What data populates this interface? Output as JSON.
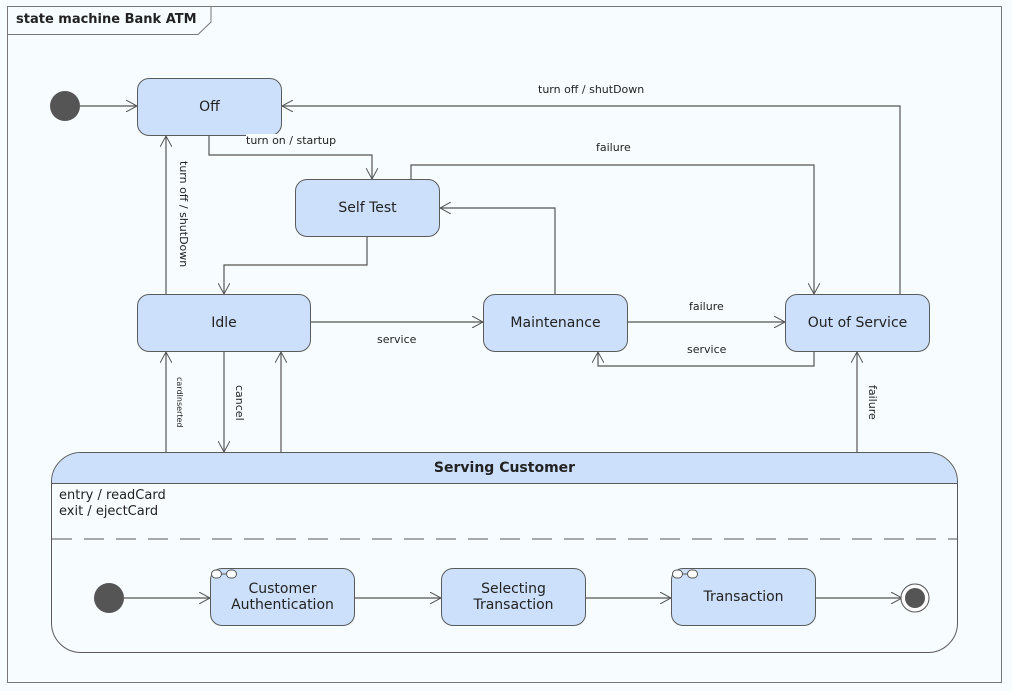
{
  "diagram": {
    "frame_title": "state machine Bank ATM",
    "states": {
      "off": "Off",
      "self_test": "Self Test",
      "idle": "Idle",
      "maintenance": "Maintenance",
      "out_of_service": "Out of Service"
    },
    "composite": {
      "name": "Serving Customer",
      "entry": "entry / readCard",
      "exit": "exit / ejectCard",
      "substates": {
        "auth_line1": "Customer",
        "auth_line2": "Authentication",
        "select_line1": "Selecting",
        "select_line2": "Transaction",
        "transaction": "Transaction"
      }
    },
    "transitions": {
      "turn_on": "turn on / startup",
      "turn_off_top": "turn off / shutDown",
      "turn_off_left": "turn off / shutDown",
      "failure_selftest": "failure",
      "service_idle": "service",
      "failure_maint": "failure",
      "service_oos": "service",
      "card_inserted": "cardInserted",
      "cancel": "cancel",
      "failure_serving": "failure"
    }
  }
}
